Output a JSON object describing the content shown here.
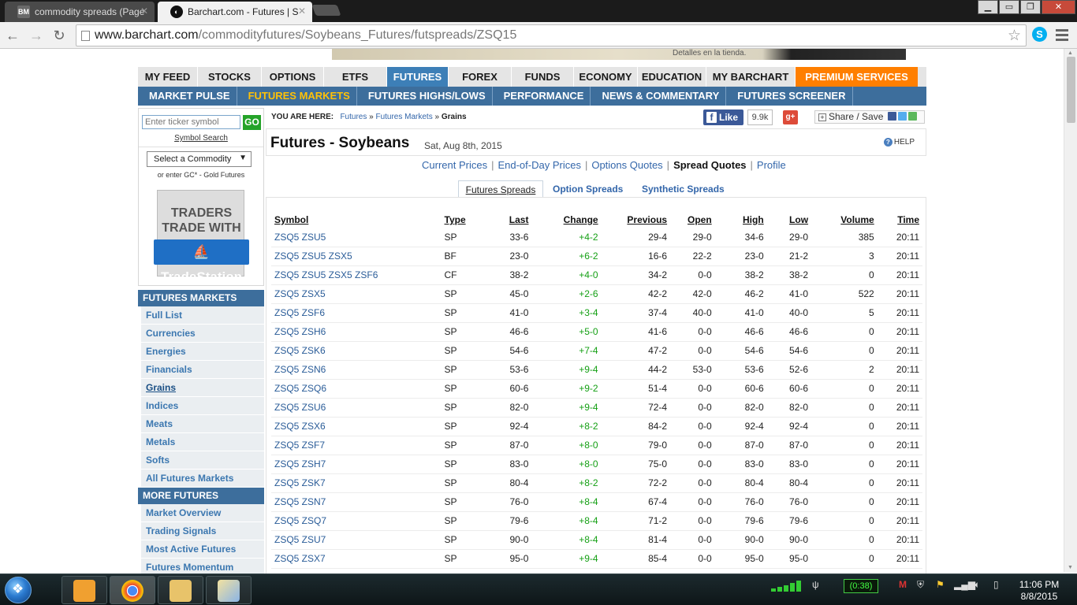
{
  "browser": {
    "tabs": [
      {
        "title": "commodity spreads (Page",
        "icon": "BM",
        "active": false
      },
      {
        "title": "Barchart.com - Futures | S",
        "icon": "barchart-icon",
        "active": true
      }
    ],
    "url_host": "www.barchart.com",
    "url_path": "/commodityfutures/Soybeans_Futures/futspreads/ZSQ15"
  },
  "ad": {
    "text": "Detalles en la tienda."
  },
  "main_nav": [
    {
      "label": "MY FEED"
    },
    {
      "label": "STOCKS"
    },
    {
      "label": "OPTIONS"
    },
    {
      "label": "ETFS"
    },
    {
      "label": "FUTURES",
      "active": true
    },
    {
      "label": "FOREX"
    },
    {
      "label": "FUNDS"
    },
    {
      "label": "ECONOMY"
    },
    {
      "label": "EDUCATION"
    },
    {
      "label": "MY BARCHART"
    },
    {
      "label": "PREMIUM SERVICES",
      "premium": true
    }
  ],
  "sub_nav": [
    {
      "label": "MARKET PULSE"
    },
    {
      "label": "FUTURES MARKETS",
      "active": true
    },
    {
      "label": "FUTURES HIGHS/LOWS"
    },
    {
      "label": "PERFORMANCE"
    },
    {
      "label": "NEWS & COMMENTARY"
    },
    {
      "label": "FUTURES SCREENER"
    }
  ],
  "sidebar": {
    "ticker_placeholder": "Enter ticker symbol",
    "go_label": "GO",
    "symbol_search": "Symbol Search",
    "commodity_select": "Select a Commodity",
    "enter_hint": "or enter GC* - Gold Futures",
    "ad": {
      "line1": "TRADERS",
      "line2": "TRADE WITH",
      "logo": "TradeStation"
    },
    "futures_markets_header": "FUTURES MARKETS",
    "futures_markets": [
      {
        "label": "Full List"
      },
      {
        "label": "Currencies"
      },
      {
        "label": "Energies"
      },
      {
        "label": "Financials"
      },
      {
        "label": "Grains",
        "current": true
      },
      {
        "label": "Indices"
      },
      {
        "label": "Meats"
      },
      {
        "label": "Metals"
      },
      {
        "label": "Softs"
      },
      {
        "label": "All Futures Markets"
      }
    ],
    "more_futures_header": "MORE FUTURES",
    "more_futures": [
      {
        "label": "Market Overview"
      },
      {
        "label": "Trading Signals"
      },
      {
        "label": "Most Active Futures"
      },
      {
        "label": "Futures Momentum"
      }
    ]
  },
  "breadcrumb": {
    "label": "YOU ARE HERE:",
    "l1": "Futures",
    "l2": "Futures Markets",
    "current": "Grains",
    "sep": "»"
  },
  "social": {
    "like": "Like",
    "like_count": "9.9k",
    "gplus": "g+",
    "share": "Share / Save"
  },
  "page": {
    "title": "Futures - Soybeans",
    "date": "Sat, Aug 8th, 2015",
    "help": "HELP"
  },
  "quote_links": [
    {
      "label": "Current Prices"
    },
    {
      "label": "End-of-Day Prices"
    },
    {
      "label": "Options Quotes"
    },
    {
      "label": "Spread Quotes",
      "active": true
    },
    {
      "label": "Profile"
    }
  ],
  "spread_tabs": [
    {
      "label": "Futures Spreads",
      "active": true
    },
    {
      "label": "Option Spreads"
    },
    {
      "label": "Synthetic Spreads"
    }
  ],
  "table": {
    "headers": [
      "Symbol",
      "Type",
      "Last",
      "Change",
      "Previous",
      "Open",
      "High",
      "Low",
      "Volume",
      "Time"
    ],
    "rows": [
      [
        "ZSQ5 ZSU5",
        "SP",
        "33-6",
        "+4-2",
        "29-4",
        "29-0",
        "34-6",
        "29-0",
        "385",
        "20:11"
      ],
      [
        "ZSQ5 ZSU5 ZSX5",
        "BF",
        "23-0",
        "+6-2",
        "16-6",
        "22-2",
        "23-0",
        "21-2",
        "3",
        "20:11"
      ],
      [
        "ZSQ5 ZSU5 ZSX5 ZSF6",
        "CF",
        "38-2",
        "+4-0",
        "34-2",
        "0-0",
        "38-2",
        "38-2",
        "0",
        "20:11"
      ],
      [
        "ZSQ5 ZSX5",
        "SP",
        "45-0",
        "+2-6",
        "42-2",
        "42-0",
        "46-2",
        "41-0",
        "522",
        "20:11"
      ],
      [
        "ZSQ5 ZSF6",
        "SP",
        "41-0",
        "+3-4",
        "37-4",
        "40-0",
        "41-0",
        "40-0",
        "5",
        "20:11"
      ],
      [
        "ZSQ5 ZSH6",
        "SP",
        "46-6",
        "+5-0",
        "41-6",
        "0-0",
        "46-6",
        "46-6",
        "0",
        "20:11"
      ],
      [
        "ZSQ5 ZSK6",
        "SP",
        "54-6",
        "+7-4",
        "47-2",
        "0-0",
        "54-6",
        "54-6",
        "0",
        "20:11"
      ],
      [
        "ZSQ5 ZSN6",
        "SP",
        "53-6",
        "+9-4",
        "44-2",
        "53-0",
        "53-6",
        "52-6",
        "2",
        "20:11"
      ],
      [
        "ZSQ5 ZSQ6",
        "SP",
        "60-6",
        "+9-2",
        "51-4",
        "0-0",
        "60-6",
        "60-6",
        "0",
        "20:11"
      ],
      [
        "ZSQ5 ZSU6",
        "SP",
        "82-0",
        "+9-4",
        "72-4",
        "0-0",
        "82-0",
        "82-0",
        "0",
        "20:11"
      ],
      [
        "ZSQ5 ZSX6",
        "SP",
        "92-4",
        "+8-2",
        "84-2",
        "0-0",
        "92-4",
        "92-4",
        "0",
        "20:11"
      ],
      [
        "ZSQ5 ZSF7",
        "SP",
        "87-0",
        "+8-0",
        "79-0",
        "0-0",
        "87-0",
        "87-0",
        "0",
        "20:11"
      ],
      [
        "ZSQ5 ZSH7",
        "SP",
        "83-0",
        "+8-0",
        "75-0",
        "0-0",
        "83-0",
        "83-0",
        "0",
        "20:11"
      ],
      [
        "ZSQ5 ZSK7",
        "SP",
        "80-4",
        "+8-2",
        "72-2",
        "0-0",
        "80-4",
        "80-4",
        "0",
        "20:11"
      ],
      [
        "ZSQ5 ZSN7",
        "SP",
        "76-0",
        "+8-4",
        "67-4",
        "0-0",
        "76-0",
        "76-0",
        "0",
        "20:11"
      ],
      [
        "ZSQ5 ZSQ7",
        "SP",
        "79-6",
        "+8-4",
        "71-2",
        "0-0",
        "79-6",
        "79-6",
        "0",
        "20:11"
      ],
      [
        "ZSQ5 ZSU7",
        "SP",
        "90-0",
        "+8-4",
        "81-4",
        "0-0",
        "90-0",
        "90-0",
        "0",
        "20:11"
      ],
      [
        "ZSQ5 ZSX7",
        "SP",
        "95-0",
        "+9-4",
        "85-4",
        "0-0",
        "95-0",
        "95-0",
        "0",
        "20:11"
      ]
    ]
  },
  "taskbar": {
    "battery_time": "0:38",
    "time": "11:06 PM",
    "date": "8/8/2015"
  },
  "colors": {
    "nav_active": "#3d7fb7",
    "sub_nav": "#3d6e9c",
    "premium": "#ff7f00",
    "up": "#15a015",
    "link": "#3366aa"
  }
}
